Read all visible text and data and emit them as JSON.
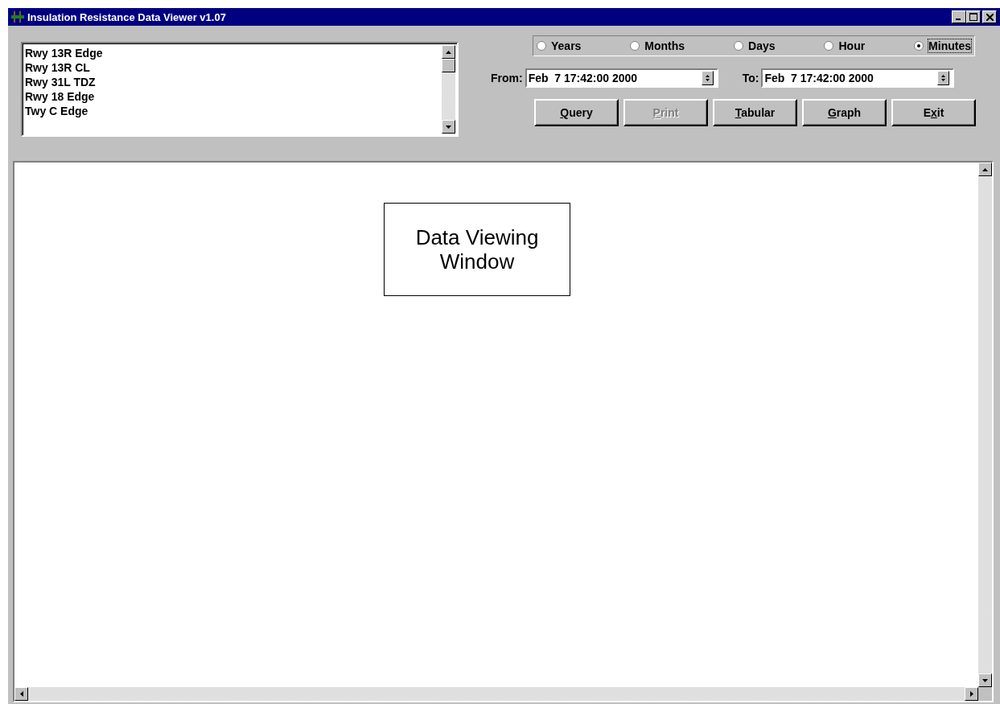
{
  "window": {
    "title": "Insulation Resistance Data Viewer v1.07"
  },
  "locations": [
    {
      "label": "Rwy 13R Edge",
      "selected": false
    },
    {
      "label": "Rwy 13R CL",
      "selected": false
    },
    {
      "label": "Rwy 31L TDZ",
      "selected": false
    },
    {
      "label": "Rwy 18 Edge",
      "selected": false
    },
    {
      "label": "Twy C Edge",
      "selected": false
    }
  ],
  "periods": [
    {
      "label": "Years",
      "selected": false
    },
    {
      "label": "Months",
      "selected": false
    },
    {
      "label": "Days",
      "selected": false
    },
    {
      "label": "Hour",
      "selected": false
    },
    {
      "label": "Minutes",
      "selected": true
    }
  ],
  "from": {
    "label": "From:",
    "value": "Feb  7 17:42:00 2000"
  },
  "to": {
    "label": "To:",
    "value": "Feb  7 17:42:00 2000"
  },
  "buttons": [
    {
      "key": "Q",
      "after": "uery",
      "disabled": false
    },
    {
      "key": "P",
      "after": "rint",
      "disabled": true
    },
    {
      "key": "T",
      "after": "abular",
      "disabled": false
    },
    {
      "key": "G",
      "after": "raph",
      "disabled": false
    },
    {
      "before": "E",
      "key": "x",
      "after": "it",
      "disabled": false
    }
  ],
  "data_view": {
    "note": "Data Viewing Window"
  }
}
